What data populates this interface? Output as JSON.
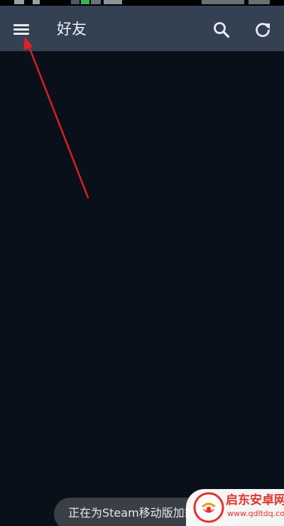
{
  "header": {
    "title": "好友"
  },
  "toast": {
    "text": "正在为Steam移动版加载"
  },
  "watermark": {
    "title": "启东安卓网",
    "url": "www.qdltdq.com"
  },
  "icons": {
    "menu": "hamburger-menu-icon",
    "search": "search-icon",
    "refresh": "refresh-icon"
  },
  "colors": {
    "app_bar": "#334153",
    "background": "#0a101a",
    "icon": "#e8ecf1",
    "annotation_arrow": "#e02020",
    "watermark_accent": "#e0342a"
  }
}
